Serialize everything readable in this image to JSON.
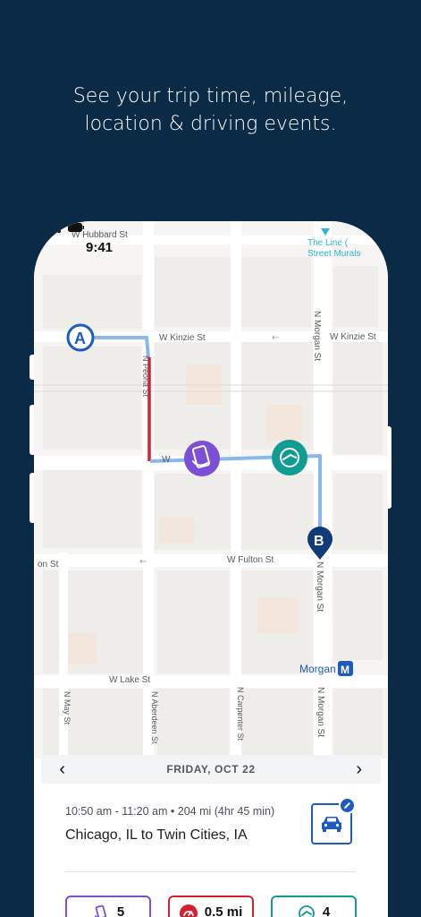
{
  "headline": {
    "line1": "See your trip time, mileage,",
    "line2": "location & driving events."
  },
  "status_bar": {
    "time": "9:41"
  },
  "map": {
    "streets": {
      "w_hubbard": "W Hubbard St",
      "w_kinzie_left": "W Kinzie St",
      "w_kinzie_right": "W Kinzie St",
      "n_morgan_top": "N Morgan St",
      "n_morgan_mid": "N Morgan St",
      "n_morgan_bottom": "N Morgan St",
      "w_fulton": "W Fulton St",
      "fulton_left": "on St",
      "w_lake": "W Lake St",
      "n_may": "N May St",
      "n_aberdeen": "N Aberdeen St",
      "n_carpenter": "N Carpenter St",
      "n_peoria": "N Peoria St",
      "w_mid": "W"
    },
    "poi_top_right": {
      "line1": "The Line (",
      "line2": "Street Murals"
    },
    "station": {
      "name": "Morgan",
      "badge": "M"
    },
    "start_marker": "A",
    "end_marker": "B"
  },
  "date_bar": {
    "label": "FRIDAY, OCT 22",
    "prev_icon": "chevron-left-icon",
    "next_icon": "chevron-right-icon"
  },
  "trip": {
    "meta": "10:50 am - 11:20 am • 204 mi (4hr 45 min)",
    "route": "Chicago, IL to Twin Cities, IA",
    "vehicle_icon": "car-icon",
    "edit_icon": "pencil-icon"
  },
  "stats": {
    "phone_use": "5",
    "speeding": "0.5 mi",
    "braking": "4"
  },
  "colors": {
    "background": "#0b2a45",
    "route": "#8ab8ee",
    "speeding": "#d6202f",
    "phone_event": "#7b4fd6",
    "braking_event": "#0f9d93",
    "accent_blue": "#1d5bbf"
  }
}
